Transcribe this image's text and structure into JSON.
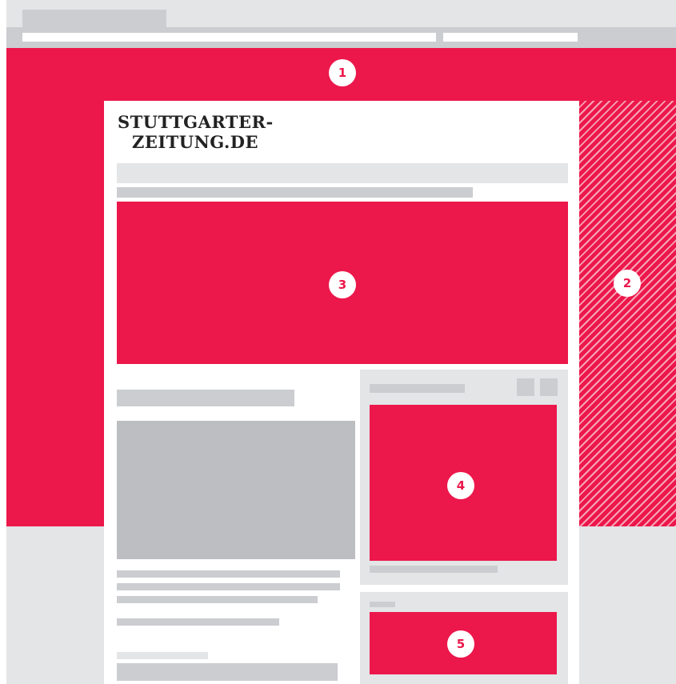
{
  "logo": {
    "line1": "STUTTGARTER-",
    "line2": "ZEITUNG.DE"
  },
  "markers": {
    "wallpaper": "1",
    "skyscraper": "2",
    "billboard": "3",
    "rectangle": "4",
    "content_ad": "5"
  },
  "colors": {
    "ad_red": "#ec174b",
    "placeholder_light": "#e3e5e7",
    "placeholder_dark": "#cbcdd0",
    "image_placeholder": "#bcbec1",
    "stripe_light": "#f6a5b6"
  }
}
